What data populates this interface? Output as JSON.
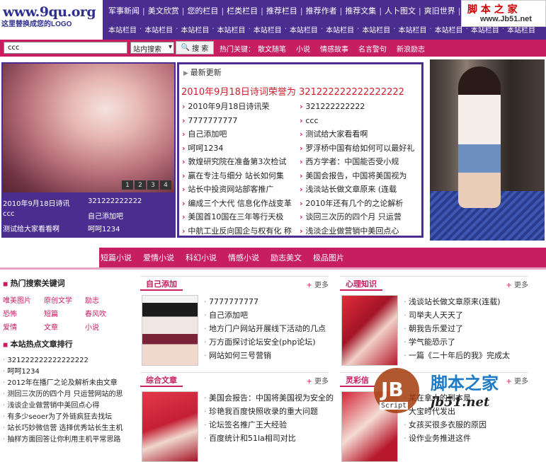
{
  "header": {
    "site": "www.9qu.org",
    "logo_caption": "这里替换成您的LOGO",
    "nav_row1": [
      "军事新闻",
      "美文欣赏",
      "您的栏目",
      "栏类栏目",
      "推荐栏目",
      "推荐作者",
      "推荐文集",
      "人卜图文",
      "爽旧世界",
      "美图"
    ],
    "nav_row2": [
      "本站栏目",
      "本站栏目",
      "本站栏目",
      "本站栏目",
      "本站栏目",
      "本站栏目",
      "本站栏目",
      "本站栏目",
      "本站栏目",
      "本站栏目",
      "本站栏目",
      "本站栏目"
    ],
    "watermark_top": {
      "brand": "脚 本 之 家",
      "url": "www.Jb51.net"
    }
  },
  "search": {
    "input_value": "ccc",
    "select_value": "站内搜索",
    "button_label": "搜 索",
    "hot_label": "热门关键：",
    "hot_items": [
      "散文随笔",
      "小说",
      "情感故事",
      "名言警句",
      "新浪励志"
    ]
  },
  "slideshow": {
    "numbers": [
      "1",
      "2",
      "3",
      "4"
    ],
    "captions": [
      {
        "left": "2010年9月18日诗讯",
        "right": "321222222222"
      },
      {
        "left": "ccc",
        "right": "自己添加吧"
      },
      {
        "left": "测试给大家看看啊",
        "right": "呵呵1234"
      }
    ]
  },
  "latest": {
    "head": "最新更新",
    "headline": "2010年9月18日诗词荣誉为 321222222222222222",
    "left": [
      "2010年9月18日诗讯荣",
      "7777777777",
      "自己添加吧",
      "呵呵1234",
      "敦煌研究院在准备第3次检试",
      "赢在专注与细分 站长如何集",
      "站长中投资网站部客推广",
      "编成三个大代 信息化作战变革",
      "美国首10国在三年等行天极",
      "中航工业反向国企与权有化 称"
    ],
    "right": [
      "321222222222",
      "ccc",
      "测试给大家看看啊",
      "罗浮桥中国有给如何可以最好礼",
      "西方学者：中国能否受小规",
      "美国会报告，中国将美国视为",
      "浅淡站长做文章原来 (连载",
      "2010年还有几个的之论解析",
      "谈回三次历的四个月 只运营",
      "浅淡企业做营销中美回点心"
    ]
  },
  "category_nav": [
    "短篇小说",
    "爱情小说",
    "科幻小说",
    "情感小说",
    "励志美文",
    "极品图片"
  ],
  "left_column": {
    "keywords_title": "热门搜索关键词",
    "keywords": [
      "唯美图片",
      "原创文学",
      "励志",
      "恐怖",
      "短篇",
      "春风吹",
      "爱情",
      "文章",
      "小说"
    ],
    "hot_title": "本站热点文章排行",
    "hot_list": [
      "321222222222222222",
      "呵呵1234",
      "2012年在播厂之论及解析未由文章",
      "测回三次历的四个月 只运营网站的思",
      "浅谈企业做营销中美回点心得",
      "有多少seoer为了外链疯狂去找坛",
      "站长巧妙微信营 选择优秀站长生主机",
      "抽样方面回答让你利用主机平常思路"
    ]
  },
  "sections": {
    "s1": {
      "title": "自己添加",
      "more": "更多",
      "items": [
        "7777777777",
        "自己添加吧",
        "地方门户网站开展线下活动的几点",
        "万方面探讨论坛安全(php论坛)",
        "网站如何三号营销"
      ]
    },
    "s2": {
      "title": "心理知识",
      "more": "更多",
      "items": [
        "浅谈站长做文章原来(连载)",
        "司举夫人天天了",
        "朝我告乐爱过了",
        "学气能恐示了",
        "一篇《二十年后的我》完成太"
      ]
    },
    "s3": {
      "title": "综合文章",
      "more": "更多",
      "items": [
        "美国会报告：中国将美国视为安全的",
        "珍艳我百度快照收录的重大问题",
        "论坛签名推广王大经验",
        "百度统计和51la相司对比"
      ]
    },
    "s4": {
      "title": "灵彩信",
      "more": "更多",
      "items": [
        "某在拿大的到本是",
        "大宝时代发出",
        "女孩买很多衣服的原因",
        "设作业务推进这件"
      ]
    }
  },
  "watermark_bottom": {
    "logo": "JB",
    "script": "Script",
    "brand": "脚本之家",
    "url": "jb51.net"
  },
  "colors": {
    "purple": "#4a2d8e",
    "pink": "#c71e62",
    "headline_red": "#d1202c"
  }
}
